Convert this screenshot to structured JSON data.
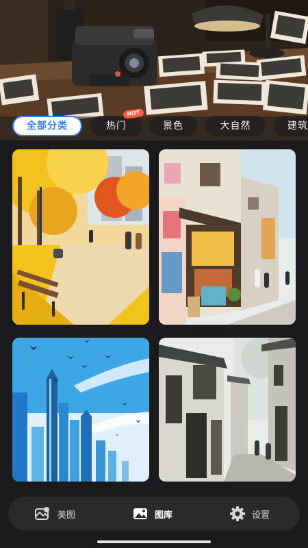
{
  "categories": {
    "items": [
      {
        "label": "全部分类",
        "active": true
      },
      {
        "label": "热门",
        "active": false
      },
      {
        "label": "景色",
        "active": false
      },
      {
        "label": "大自然",
        "active": false
      },
      {
        "label": "建筑",
        "active": false
      }
    ],
    "hot_badge": "HOT"
  },
  "gallery": {
    "images": [
      {
        "subject": "autumn park with yellow ginkgo trees and bench"
      },
      {
        "subject": "colorful street corner shop with graffiti"
      },
      {
        "subject": "blue skyscrapers with flying birds"
      },
      {
        "subject": "misty old town alley"
      }
    ]
  },
  "bottom_nav": {
    "items": [
      {
        "label": "美图",
        "icon": "photo-edit-icon",
        "active": false
      },
      {
        "label": "图库",
        "icon": "gallery-icon",
        "active": true
      },
      {
        "label": "设置",
        "icon": "gear-icon",
        "active": false
      }
    ]
  },
  "colors": {
    "accent": "#2d7cf6",
    "background": "#1b1b1d",
    "nav_background": "#2a2a2d"
  }
}
